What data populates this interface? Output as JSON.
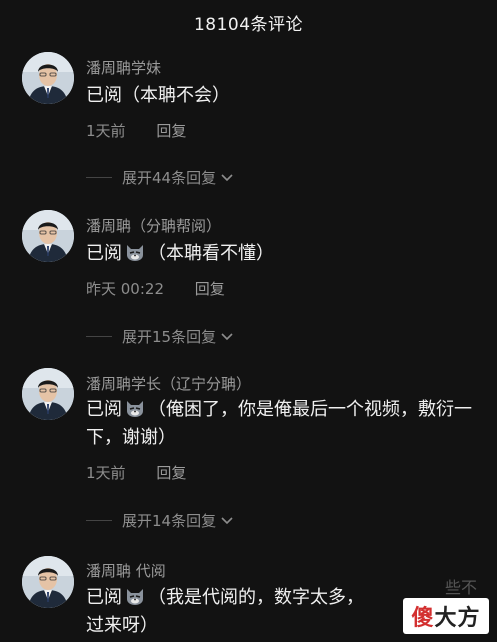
{
  "header": {
    "title": "18104条评论"
  },
  "comments": [
    {
      "username": "潘周聃学妹",
      "text_before": "已阅（本聃不会）",
      "text_after": "",
      "has_emoji": false,
      "time": "1天前",
      "reply": "回复",
      "expand": "展开44条回复"
    },
    {
      "username": "潘周聃（分聃帮阅）",
      "text_before": "已阅",
      "text_after": "（本聃看不懂）",
      "has_emoji": true,
      "time": "昨天 00:22",
      "reply": "回复",
      "expand": "展开15条回复"
    },
    {
      "username": "潘周聃学长（辽宁分聃）",
      "text_before": "已阅",
      "text_after": "（俺困了，你是俺最后一个视频，敷衍一下，谢谢）",
      "has_emoji": true,
      "time": "1天前",
      "reply": "回复",
      "expand": "展开14条回复"
    },
    {
      "username": "潘周聃 代阅",
      "text_before": "已阅",
      "text_after": "（我是代阅的，数字太多，",
      "text_line2": "过来呀）",
      "has_emoji": true
    }
  ],
  "watermark": {
    "part1": "傻",
    "part2": "大方",
    "ghost": "些不"
  },
  "icons": {
    "expand": "chevron-down-icon",
    "emoji": "cat-face-emoji-icon"
  }
}
